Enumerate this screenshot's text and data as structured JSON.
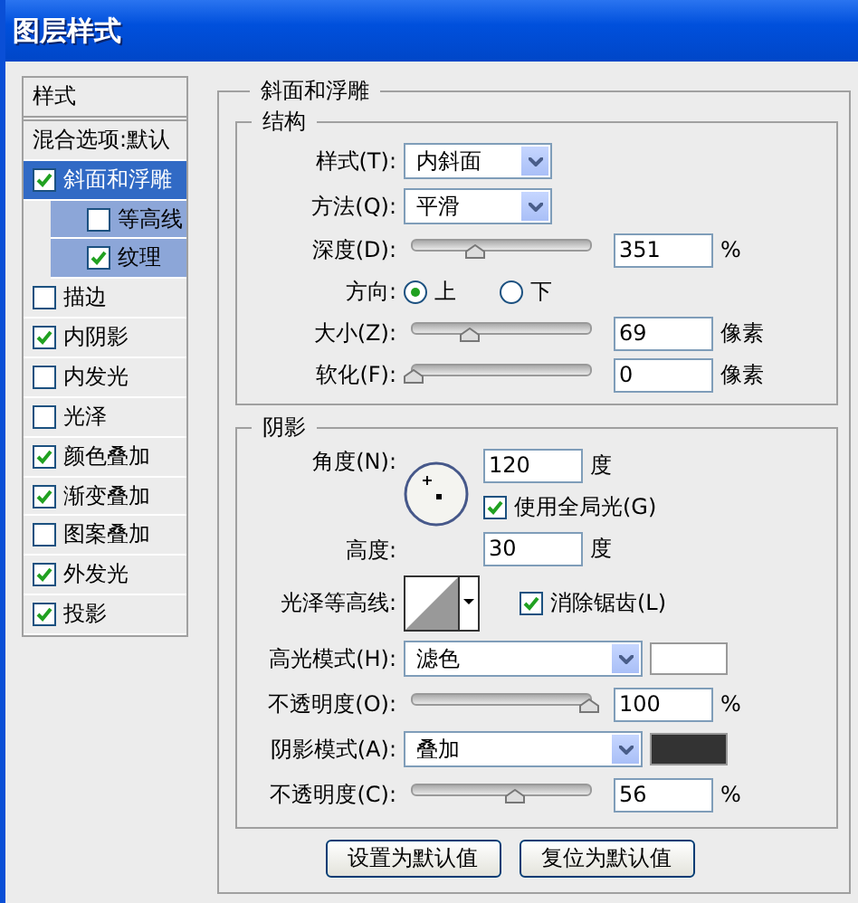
{
  "window": {
    "title": "图层样式"
  },
  "sidebar": {
    "header": "样式",
    "blend_options": "混合选项:默认",
    "items": [
      {
        "label": "斜面和浮雕",
        "checked": true,
        "selected": true,
        "children": [
          {
            "label": "等高线",
            "checked": false,
            "selected": false
          },
          {
            "label": "纹理",
            "checked": true,
            "selected": false
          }
        ]
      },
      {
        "label": "描边",
        "checked": false,
        "selected": false
      },
      {
        "label": "内阴影",
        "checked": true,
        "selected": false
      },
      {
        "label": "内发光",
        "checked": false,
        "selected": false
      },
      {
        "label": "光泽",
        "checked": false,
        "selected": false
      },
      {
        "label": "颜色叠加",
        "checked": true,
        "selected": false
      },
      {
        "label": "渐变叠加",
        "checked": true,
        "selected": false
      },
      {
        "label": "图案叠加",
        "checked": false,
        "selected": false
      },
      {
        "label": "外发光",
        "checked": true,
        "selected": false
      },
      {
        "label": "投影",
        "checked": true,
        "selected": false
      }
    ]
  },
  "panel": {
    "title": "斜面和浮雕",
    "structure": {
      "title": "结构",
      "style": {
        "label": "样式(T):",
        "value": "内斜面"
      },
      "technique": {
        "label": "方法(Q):",
        "value": "平滑"
      },
      "depth": {
        "label": "深度(D):",
        "level": 0.35,
        "value": "351",
        "unit": "%"
      },
      "direction": {
        "label": "方向:",
        "options": [
          {
            "label": "上",
            "selected": true
          },
          {
            "label": "下",
            "selected": false
          }
        ]
      },
      "size": {
        "label": "大小(Z):",
        "level": 0.32,
        "value": "69",
        "unit": "像素"
      },
      "soften": {
        "label": "软化(F):",
        "level": 0,
        "value": "0",
        "unit": "像素"
      }
    },
    "shading": {
      "title": "阴影",
      "angle": {
        "label": "角度(N):",
        "value": "120",
        "unit": "度"
      },
      "global_light": {
        "label": "使用全局光(G)",
        "checked": true
      },
      "altitude": {
        "label": "高度:",
        "value": "30",
        "unit": "度"
      },
      "gloss_contour": {
        "label": "光泽等高线:"
      },
      "anti_aliased": {
        "label": "消除锯齿(L)",
        "checked": true
      },
      "highlight_mode": {
        "label": "高光模式(H):",
        "value": "滤色",
        "color": "#ffffff"
      },
      "highlight_opacity": {
        "label": "不透明度(O):",
        "level": 0.99,
        "value": "100",
        "unit": "%"
      },
      "shadow_mode": {
        "label": "阴影模式(A):",
        "value": "叠加",
        "color": "#333333"
      },
      "shadow_opacity": {
        "label": "不透明度(C):",
        "level": 0.57,
        "value": "56",
        "unit": "%"
      }
    }
  },
  "buttons": [
    "设置为默认值",
    "复位为默认值"
  ]
}
